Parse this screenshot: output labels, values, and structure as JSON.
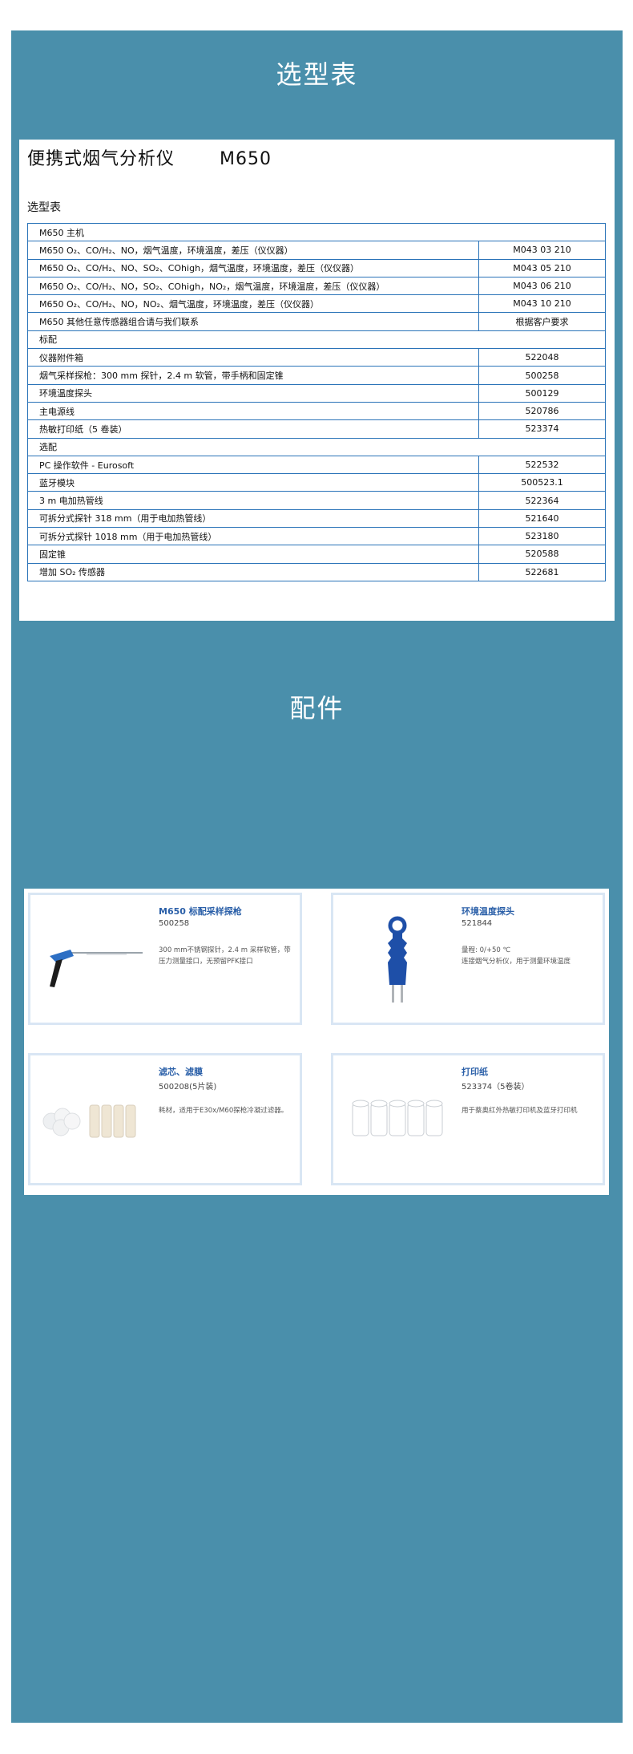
{
  "section1_title": "选型表",
  "product": {
    "title": "便携式烟气分析仪",
    "model": "M650"
  },
  "table_title": "选型表",
  "rows": [
    {
      "label": "M650 主机",
      "code": null
    },
    {
      "label": "M650 O₂、CO/H₂、NO，烟气温度，环境温度，差压（仪仪器）",
      "code": "M043 03 210"
    },
    {
      "label": "M650 O₂、CO/H₂、NO、SO₂、COhigh，烟气温度，环境温度，差压（仪仪器）",
      "code": "M043 05 210"
    },
    {
      "label": "M650 O₂、CO/H₂、NO，SO₂、COhigh，NO₂，烟气温度，环境温度，差压（仪仪器）",
      "code": "M043 06 210"
    },
    {
      "label": "M650 O₂、CO/H₂、NO，NO₂、烟气温度，环境温度，差压（仪仪器）",
      "code": "M043 10 210"
    },
    {
      "label": "M650 其他任意传感器组合请与我们联系",
      "code": "根据客户要求"
    },
    {
      "label": "标配",
      "code": null
    },
    {
      "label": "仪器附件箱",
      "code": "522048"
    },
    {
      "label": "烟气采样探枪：300 mm 探针，2.4 m 软管，带手柄和固定锥",
      "code": "500258"
    },
    {
      "label": "环境温度探头",
      "code": "500129"
    },
    {
      "label": "主电源线",
      "code": "520786"
    },
    {
      "label": "热敏打印纸（5 卷装）",
      "code": "523374"
    },
    {
      "label": "选配",
      "code": null
    },
    {
      "label": "PC 操作软件 - Eurosoft",
      "code": "522532"
    },
    {
      "label": "蓝牙模块",
      "code": "500523.1"
    },
    {
      "label": "3 m 电加热管线",
      "code": "522364"
    },
    {
      "label": "可拆分式探针 318 mm（用于电加热管线）",
      "code": "521640"
    },
    {
      "label": "可拆分式探针 1018 mm（用于电加热管线）",
      "code": "523180"
    },
    {
      "label": "固定锥",
      "code": "520588"
    },
    {
      "label": "增加 SO₂ 传感器",
      "code": "522681"
    }
  ],
  "section2_title": "配件",
  "accessories": [
    {
      "name": "M650 标配采样探枪",
      "code": "500258",
      "desc": "300 mm不锈钢探针，2.4 m 采样软管，带压力测量接口，无预留PFK接口",
      "icon": "probe-gun-icon"
    },
    {
      "name": "环境温度探头",
      "code": "521844",
      "desc": "量程: 0/+50 ℃\n连接烟气分析仪，用于测量环境温度",
      "icon": "temperature-probe-icon"
    },
    {
      "name": "滤芯、滤膜",
      "code": "500208(5片装)",
      "desc": "耗材，适用于E30x/M60探枪冷凝过滤器。",
      "icon": "filter-icon"
    },
    {
      "name": "打印纸",
      "code": "523374（5卷装）",
      "desc": "用于蔡奥红外热敏打印机及蓝牙打印机",
      "icon": "paper-roll-icon"
    }
  ],
  "colors": {
    "panel": "#4a8fab",
    "table_border": "#2a73b8",
    "accent": "#2a5fa8",
    "card_border": "#d9e6f4"
  }
}
